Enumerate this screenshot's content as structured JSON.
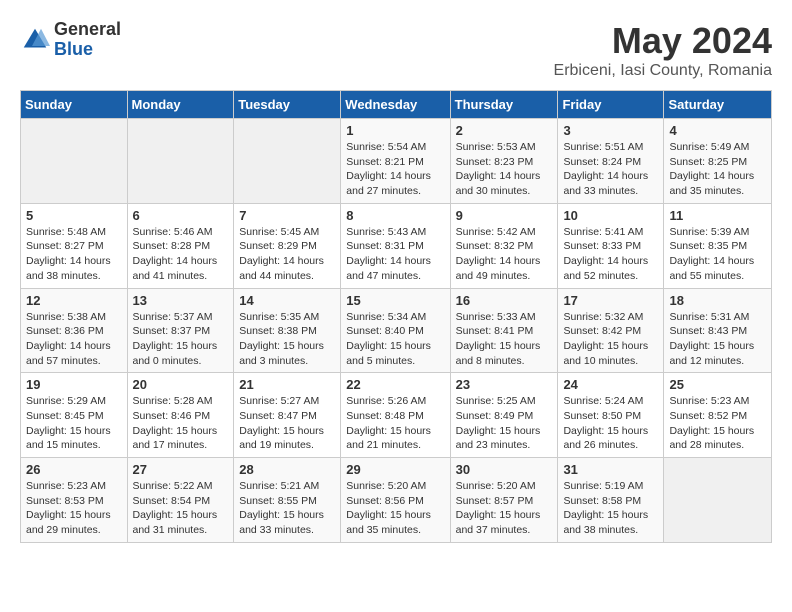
{
  "logo": {
    "general": "General",
    "blue": "Blue"
  },
  "header": {
    "title": "May 2024",
    "subtitle": "Erbiceni, Iasi County, Romania"
  },
  "weekdays": [
    "Sunday",
    "Monday",
    "Tuesday",
    "Wednesday",
    "Thursday",
    "Friday",
    "Saturday"
  ],
  "weeks": [
    [
      {
        "day": "",
        "info": ""
      },
      {
        "day": "",
        "info": ""
      },
      {
        "day": "",
        "info": ""
      },
      {
        "day": "1",
        "info": "Sunrise: 5:54 AM\nSunset: 8:21 PM\nDaylight: 14 hours and 27 minutes."
      },
      {
        "day": "2",
        "info": "Sunrise: 5:53 AM\nSunset: 8:23 PM\nDaylight: 14 hours and 30 minutes."
      },
      {
        "day": "3",
        "info": "Sunrise: 5:51 AM\nSunset: 8:24 PM\nDaylight: 14 hours and 33 minutes."
      },
      {
        "day": "4",
        "info": "Sunrise: 5:49 AM\nSunset: 8:25 PM\nDaylight: 14 hours and 35 minutes."
      }
    ],
    [
      {
        "day": "5",
        "info": "Sunrise: 5:48 AM\nSunset: 8:27 PM\nDaylight: 14 hours and 38 minutes."
      },
      {
        "day": "6",
        "info": "Sunrise: 5:46 AM\nSunset: 8:28 PM\nDaylight: 14 hours and 41 minutes."
      },
      {
        "day": "7",
        "info": "Sunrise: 5:45 AM\nSunset: 8:29 PM\nDaylight: 14 hours and 44 minutes."
      },
      {
        "day": "8",
        "info": "Sunrise: 5:43 AM\nSunset: 8:31 PM\nDaylight: 14 hours and 47 minutes."
      },
      {
        "day": "9",
        "info": "Sunrise: 5:42 AM\nSunset: 8:32 PM\nDaylight: 14 hours and 49 minutes."
      },
      {
        "day": "10",
        "info": "Sunrise: 5:41 AM\nSunset: 8:33 PM\nDaylight: 14 hours and 52 minutes."
      },
      {
        "day": "11",
        "info": "Sunrise: 5:39 AM\nSunset: 8:35 PM\nDaylight: 14 hours and 55 minutes."
      }
    ],
    [
      {
        "day": "12",
        "info": "Sunrise: 5:38 AM\nSunset: 8:36 PM\nDaylight: 14 hours and 57 minutes."
      },
      {
        "day": "13",
        "info": "Sunrise: 5:37 AM\nSunset: 8:37 PM\nDaylight: 15 hours and 0 minutes."
      },
      {
        "day": "14",
        "info": "Sunrise: 5:35 AM\nSunset: 8:38 PM\nDaylight: 15 hours and 3 minutes."
      },
      {
        "day": "15",
        "info": "Sunrise: 5:34 AM\nSunset: 8:40 PM\nDaylight: 15 hours and 5 minutes."
      },
      {
        "day": "16",
        "info": "Sunrise: 5:33 AM\nSunset: 8:41 PM\nDaylight: 15 hours and 8 minutes."
      },
      {
        "day": "17",
        "info": "Sunrise: 5:32 AM\nSunset: 8:42 PM\nDaylight: 15 hours and 10 minutes."
      },
      {
        "day": "18",
        "info": "Sunrise: 5:31 AM\nSunset: 8:43 PM\nDaylight: 15 hours and 12 minutes."
      }
    ],
    [
      {
        "day": "19",
        "info": "Sunrise: 5:29 AM\nSunset: 8:45 PM\nDaylight: 15 hours and 15 minutes."
      },
      {
        "day": "20",
        "info": "Sunrise: 5:28 AM\nSunset: 8:46 PM\nDaylight: 15 hours and 17 minutes."
      },
      {
        "day": "21",
        "info": "Sunrise: 5:27 AM\nSunset: 8:47 PM\nDaylight: 15 hours and 19 minutes."
      },
      {
        "day": "22",
        "info": "Sunrise: 5:26 AM\nSunset: 8:48 PM\nDaylight: 15 hours and 21 minutes."
      },
      {
        "day": "23",
        "info": "Sunrise: 5:25 AM\nSunset: 8:49 PM\nDaylight: 15 hours and 23 minutes."
      },
      {
        "day": "24",
        "info": "Sunrise: 5:24 AM\nSunset: 8:50 PM\nDaylight: 15 hours and 26 minutes."
      },
      {
        "day": "25",
        "info": "Sunrise: 5:23 AM\nSunset: 8:52 PM\nDaylight: 15 hours and 28 minutes."
      }
    ],
    [
      {
        "day": "26",
        "info": "Sunrise: 5:23 AM\nSunset: 8:53 PM\nDaylight: 15 hours and 29 minutes."
      },
      {
        "day": "27",
        "info": "Sunrise: 5:22 AM\nSunset: 8:54 PM\nDaylight: 15 hours and 31 minutes."
      },
      {
        "day": "28",
        "info": "Sunrise: 5:21 AM\nSunset: 8:55 PM\nDaylight: 15 hours and 33 minutes."
      },
      {
        "day": "29",
        "info": "Sunrise: 5:20 AM\nSunset: 8:56 PM\nDaylight: 15 hours and 35 minutes."
      },
      {
        "day": "30",
        "info": "Sunrise: 5:20 AM\nSunset: 8:57 PM\nDaylight: 15 hours and 37 minutes."
      },
      {
        "day": "31",
        "info": "Sunrise: 5:19 AM\nSunset: 8:58 PM\nDaylight: 15 hours and 38 minutes."
      },
      {
        "day": "",
        "info": ""
      }
    ]
  ]
}
